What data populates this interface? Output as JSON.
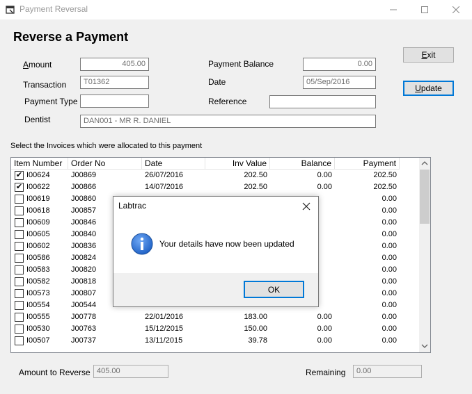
{
  "window": {
    "title": "Payment Reversal"
  },
  "page": {
    "heading": "Reverse a Payment"
  },
  "form": {
    "amount_label": "Amount",
    "amount_value": "405.00",
    "transaction_label": "Transaction",
    "transaction_value": "T01362",
    "payment_type_label": "Payment Type",
    "payment_type_value": "",
    "dentist_label": "Dentist",
    "dentist_value": "DAN001 - MR R. DANIEL",
    "payment_balance_label": "Payment Balance",
    "payment_balance_value": "0.00",
    "date_label": "Date",
    "date_value": "05/Sep/2016",
    "reference_label": "Reference",
    "reference_value": ""
  },
  "buttons": {
    "exit": "Exit",
    "update": "Update"
  },
  "invoices": {
    "instruction": "Select the Invoices which were allocated to this payment",
    "columns": [
      "Item Number",
      "Order No",
      "Date",
      "Inv Value",
      "Balance",
      "Payment"
    ],
    "rows": [
      {
        "item": "I00624",
        "order": "J00869",
        "date": "26/07/2016",
        "inv": "202.50",
        "balance": "0.00",
        "payment": "202.50",
        "checked": true
      },
      {
        "item": "I00622",
        "order": "J00866",
        "date": "14/07/2016",
        "inv": "202.50",
        "balance": "0.00",
        "payment": "202.50",
        "checked": true
      },
      {
        "item": "I00619",
        "order": "J00860",
        "date": "",
        "inv": "",
        "balance": "",
        "payment": "0.00",
        "checked": false
      },
      {
        "item": "I00618",
        "order": "J00857",
        "date": "",
        "inv": "",
        "balance": "",
        "payment": "0.00",
        "checked": false
      },
      {
        "item": "I00609",
        "order": "J00846",
        "date": "",
        "inv": "",
        "balance": "",
        "payment": "0.00",
        "checked": false
      },
      {
        "item": "I00605",
        "order": "J00840",
        "date": "",
        "inv": "",
        "balance": "",
        "payment": "0.00",
        "checked": false
      },
      {
        "item": "I00602",
        "order": "J00836",
        "date": "",
        "inv": "",
        "balance": "",
        "payment": "0.00",
        "checked": false
      },
      {
        "item": "I00586",
        "order": "J00824",
        "date": "",
        "inv": "",
        "balance": "",
        "payment": "0.00",
        "checked": false
      },
      {
        "item": "I00583",
        "order": "J00820",
        "date": "",
        "inv": "",
        "balance": "",
        "payment": "0.00",
        "checked": false
      },
      {
        "item": "I00582",
        "order": "J00818",
        "date": "",
        "inv": "",
        "balance": "",
        "payment": "0.00",
        "checked": false
      },
      {
        "item": "I00573",
        "order": "J00807",
        "date": "",
        "inv": "",
        "balance": "",
        "payment": "0.00",
        "checked": false
      },
      {
        "item": "I00554",
        "order": "J00544",
        "date": "",
        "inv": "",
        "balance": "",
        "payment": "0.00",
        "checked": false
      },
      {
        "item": "I00555",
        "order": "J00778",
        "date": "22/01/2016",
        "inv": "183.00",
        "balance": "0.00",
        "payment": "0.00",
        "checked": false
      },
      {
        "item": "I00530",
        "order": "J00763",
        "date": "15/12/2015",
        "inv": "150.00",
        "balance": "0.00",
        "payment": "0.00",
        "checked": false
      },
      {
        "item": "I00507",
        "order": "J00737",
        "date": "13/11/2015",
        "inv": "39.78",
        "balance": "0.00",
        "payment": "0.00",
        "checked": false
      }
    ]
  },
  "footer": {
    "amount_to_reverse_label": "Amount to Reverse",
    "amount_to_reverse_value": "405.00",
    "remaining_label": "Remaining",
    "remaining_value": "0.00"
  },
  "dialog": {
    "title": "Labtrac",
    "message": "Your details have now been updated",
    "ok": "OK"
  },
  "icons": {
    "info": "info-icon",
    "close": "close-icon"
  },
  "colors": {
    "info_blue": "#1c5fc4",
    "focus_blue": "#0078d7"
  }
}
